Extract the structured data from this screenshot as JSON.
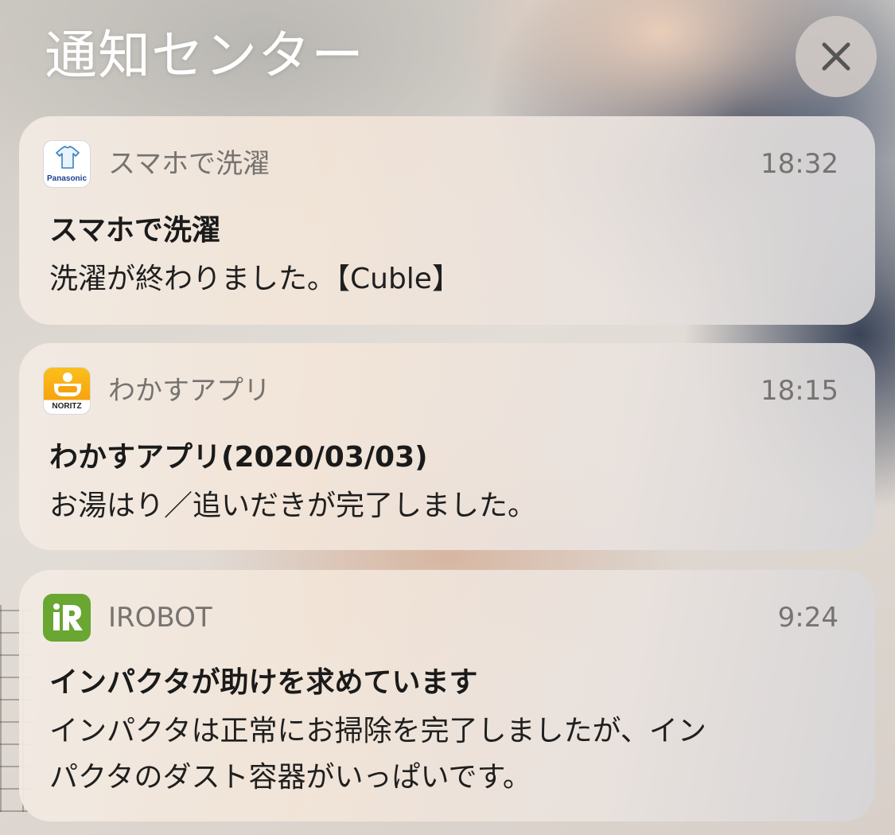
{
  "header": {
    "title": "通知センター",
    "close_icon": "close-icon"
  },
  "notifications": [
    {
      "app_name": "スマホで洗濯",
      "app_icon": "panasonic-laundry-icon",
      "app_icon_text": "Panasonic",
      "time": "18:32",
      "title": "スマホで洗濯",
      "body": "洗濯が終わりました。【Cuble】"
    },
    {
      "app_name": "わかすアプリ",
      "app_icon": "noritz-bath-icon",
      "app_icon_text": "NORITZ",
      "time": "18:15",
      "title": "わかすアプリ(2020/03/03)",
      "body": "お湯はり／追いだきが完了しました。"
    },
    {
      "app_name": "IROBOT",
      "app_icon": "irobot-icon",
      "time": "9:24",
      "title": "インパクタが助けを求めています",
      "body": "インパクタは正常にお掃除を完了しましたが、イン\nパクタのダスト容器がいっぱいです。"
    }
  ],
  "colors": {
    "panasonic_blue": "#1c3f94",
    "noritz_orange": "#f6a30f",
    "irobot_green": "#6aa632"
  }
}
